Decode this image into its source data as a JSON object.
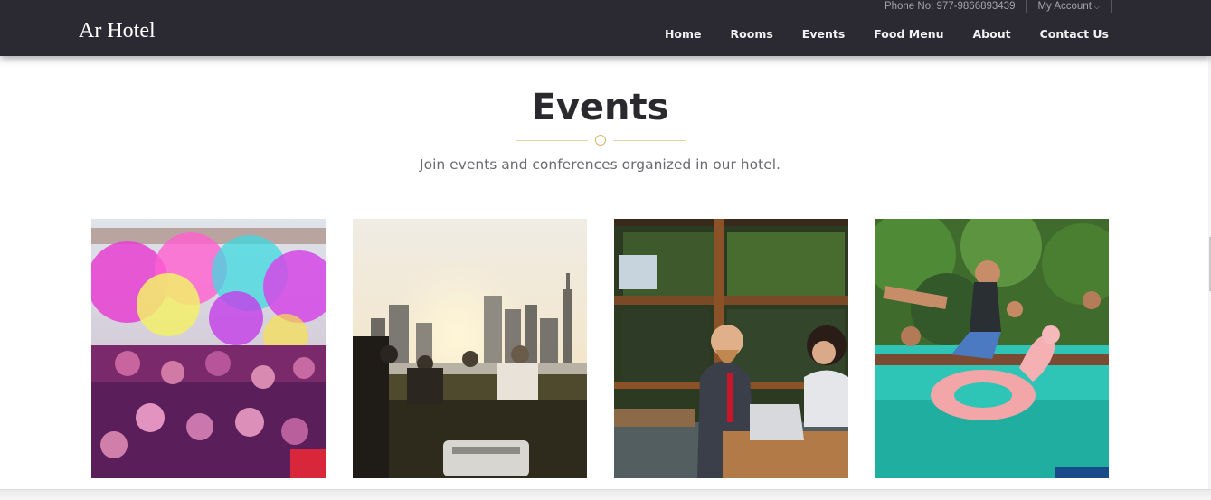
{
  "brand": {
    "name": "Ar Hotel"
  },
  "utility": {
    "phone": "Phone No: 977-9866893439",
    "account": "My Account"
  },
  "nav": {
    "items": [
      {
        "label": "Home"
      },
      {
        "label": "Rooms"
      },
      {
        "label": "Events"
      },
      {
        "label": "Food Menu"
      },
      {
        "label": "About"
      },
      {
        "label": "Contact Us"
      }
    ]
  },
  "section": {
    "title": "Events",
    "subtitle": "Join events and conferences organized in our hotel."
  },
  "events": [
    {
      "image": "color-festival-crowd"
    },
    {
      "image": "city-skyline-picnic-sunset"
    },
    {
      "image": "business-meeting-cafe"
    },
    {
      "image": "pool-party"
    }
  ],
  "colors": {
    "header_bg": "#2b2a33",
    "accent_gold": "#d8b46a",
    "heading": "#2a2a2e"
  }
}
